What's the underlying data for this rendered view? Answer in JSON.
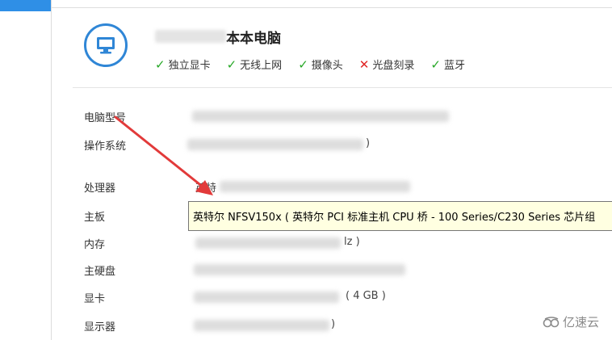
{
  "header": {
    "title_suffix": "本本电脑",
    "features": [
      {
        "label": "独立显卡",
        "supported": true
      },
      {
        "label": "无线上网",
        "supported": true
      },
      {
        "label": "摄像头",
        "supported": true
      },
      {
        "label": "光盘刻录",
        "supported": false
      },
      {
        "label": "蓝牙",
        "supported": true
      }
    ],
    "check_glyph": "✓",
    "cross_glyph": "✕"
  },
  "specs": {
    "model_label": "电脑型号",
    "os_label": "操作系统",
    "os_value_tail": ")",
    "cpu_label": "处理器",
    "cpu_value_head": "英特",
    "board_label": "主板",
    "board_value": "英特尔 NFSV150x ( 英特尔 PCI 标准主机 CPU 桥 - 100 Series/C230 Series 芯片组",
    "memory_label": "内存",
    "memory_value_tail": "lz )",
    "disk_label": "主硬盘",
    "gpu_label": "显卡",
    "gpu_value_tail": "( 4 GB )",
    "monitor_label": "显示器",
    "monitor_value_tail": ")"
  },
  "watermark": {
    "text": "亿速云"
  },
  "colors": {
    "accent": "#2f86d6",
    "ok": "#27a827",
    "no": "#e02525",
    "arrow": "#e23a3a",
    "tooltip_bg": "#ffffe1"
  }
}
